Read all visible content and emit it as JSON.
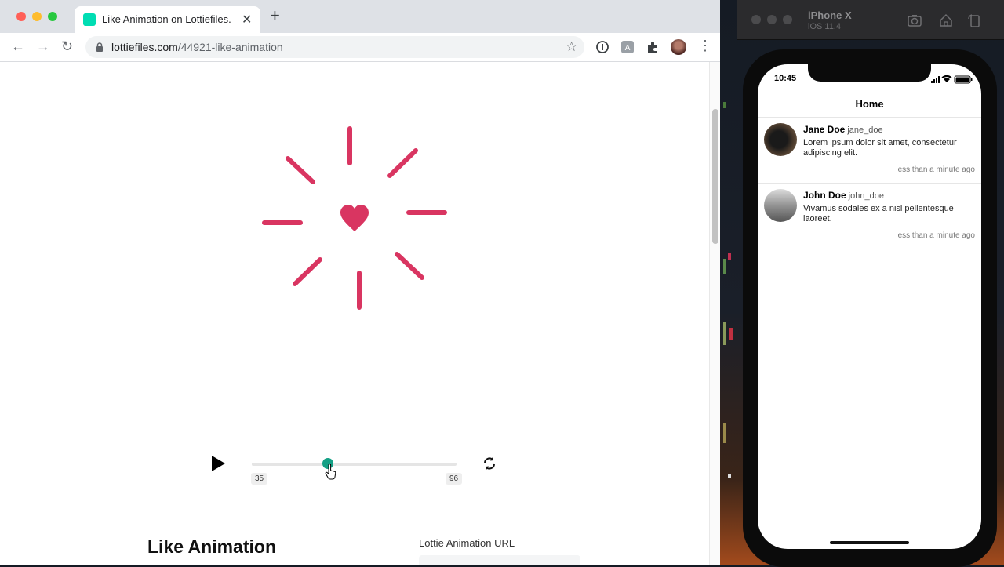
{
  "browser": {
    "tab_title": "Like Animation on Lottiefiles. F",
    "url_host": "lottiefiles.com",
    "url_path": "/44921-like-animation"
  },
  "player": {
    "frame_start": "35",
    "frame_end": "96",
    "progress": 0.37
  },
  "page": {
    "animation_title": "Like Animation",
    "url_label": "Lottie Animation URL"
  },
  "colors": {
    "accent": "#14a085",
    "heart": "#d93561"
  },
  "simulator": {
    "device": "iPhone X",
    "os": "iOS 11.4"
  },
  "phone": {
    "time": "10:45",
    "nav_title": "Home",
    "posts": [
      {
        "name": "Jane Doe",
        "handle": "jane_doe",
        "text": "Lorem ipsum dolor sit amet, consectetur adipiscing elit.",
        "time": "less than a minute ago"
      },
      {
        "name": "John Doe",
        "handle": "john_doe",
        "text": "Vivamus sodales ex a nisl pellentesque laoreet.",
        "time": "less than a minute ago"
      }
    ]
  }
}
